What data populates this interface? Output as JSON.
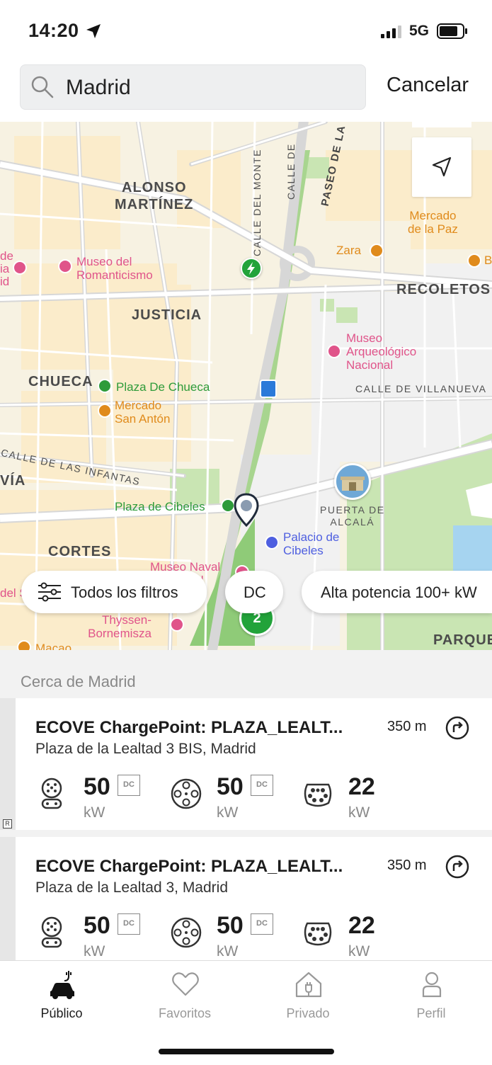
{
  "status_bar": {
    "time": "14:20",
    "network": "5G"
  },
  "search": {
    "value": "Madrid",
    "cancel_label": "Cancelar"
  },
  "map": {
    "district_labels": [
      "ALONSO",
      "MARTÍNEZ",
      "JUSTICIA",
      "CHUECA",
      "RECOLETOS",
      "CORTES",
      "VÍA",
      "PARQUE"
    ],
    "street_labels": [
      "CALLE DEL MONTE",
      "CALLE DE",
      "PASEO DE LA",
      "CALLE DE VILLANUEVA",
      "CALLE DE LAS INFANTAS"
    ],
    "pois": {
      "museo_romanticismo": "Museo del\nRomanticismo",
      "plaza_chueca": "Plaza De Chueca",
      "mercado_san_anton": "Mercado\nSan Antón",
      "mercado_paz": "Mercado\nde la Paz",
      "zara": "Zara",
      "museo_arqueologico": "Museo\nArqueológico\nNacional",
      "plaza_cibeles": "Plaza de Cibeles",
      "puerta_alcala": "PUERTA DE\nALCALÁ",
      "palacio_cibeles": "Palacio de\nCibeles",
      "museo_naval": "Museo Naval\nde Madrid",
      "museo_thyssen": "Museo Nacional\nThyssen-\nBornemisza",
      "macao": "Macao",
      "edge_left_a": "de",
      "edge_left_b": "ia",
      "edge_left_c": "id",
      "edge_left_d": "del S",
      "edge_right_e": "B"
    },
    "cluster_count": "2"
  },
  "filters": {
    "all_filters": "Todos los filtros",
    "dc": "DC",
    "high_power": "Alta potencia 100+ kW"
  },
  "list": {
    "header": "Cerca de Madrid",
    "stations": [
      {
        "name": "ECOVE ChargePoint: PLAZA_LEALT...",
        "distance": "350 m",
        "address": "Plaza de la Lealtad 3 BIS, Madrid",
        "connectors": [
          {
            "power": "50",
            "unit": "kW",
            "dc": "DC",
            "icon": "ccs-connector-icon"
          },
          {
            "power": "50",
            "unit": "kW",
            "dc": "DC",
            "icon": "chademo-connector-icon"
          },
          {
            "power": "22",
            "unit": "kW",
            "dc": "",
            "icon": "type2-connector-icon"
          }
        ]
      },
      {
        "name": "ECOVE ChargePoint: PLAZA_LEALT...",
        "distance": "350 m",
        "address": "Plaza de la Lealtad 3, Madrid",
        "connectors": [
          {
            "power": "50",
            "unit": "kW",
            "dc": "DC",
            "icon": "ccs-connector-icon"
          },
          {
            "power": "50",
            "unit": "kW",
            "dc": "DC",
            "icon": "chademo-connector-icon"
          },
          {
            "power": "22",
            "unit": "kW",
            "dc": "",
            "icon": "type2-connector-icon"
          }
        ]
      }
    ],
    "badge": "R"
  },
  "tabs": [
    {
      "label": "Público",
      "icon": "ev-car-icon",
      "active": true
    },
    {
      "label": "Favoritos",
      "icon": "heart-icon",
      "active": false
    },
    {
      "label": "Privado",
      "icon": "home-plug-icon",
      "active": false
    },
    {
      "label": "Perfil",
      "icon": "person-icon",
      "active": false
    }
  ],
  "colors": {
    "poi_pink": "#e0548a",
    "poi_green": "#2e9b3a",
    "poi_orange": "#e08b1c",
    "charger_green": "#22a33a",
    "park_green": "#c9e5b3"
  }
}
